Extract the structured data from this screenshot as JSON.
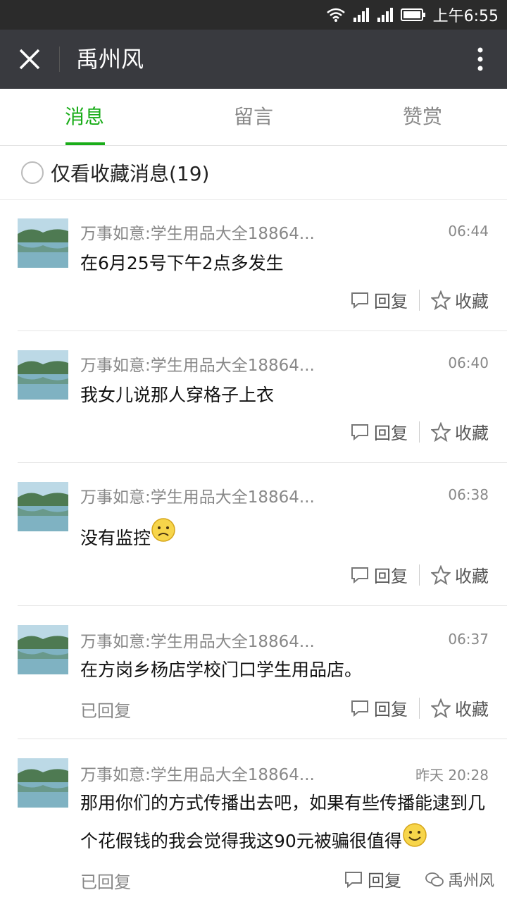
{
  "status_bar": {
    "time": "上午6:55"
  },
  "header": {
    "title": "禹州风"
  },
  "tabs": [
    {
      "label": "消息",
      "active": true
    },
    {
      "label": "留言",
      "active": false
    },
    {
      "label": "赞赏",
      "active": false
    }
  ],
  "filter": {
    "label": "仅看收藏消息(19)"
  },
  "actions": {
    "reply": "回复",
    "favorite": "收藏",
    "replied": "已回复"
  },
  "messages": [
    {
      "nickname": "万事如意:学生用品大全18864...",
      "time": "06:44",
      "content": "在6月25号下午2点多发生",
      "replied": false
    },
    {
      "nickname": "万事如意:学生用品大全18864...",
      "time": "06:40",
      "content": "我女儿说那人穿格子上衣",
      "replied": false
    },
    {
      "nickname": "万事如意:学生用品大全18864...",
      "time": "06:38",
      "content": "没有监控",
      "emoji": "sad-face-icon",
      "replied": false
    },
    {
      "nickname": "万事如意:学生用品大全18864...",
      "time": "06:37",
      "content": "在方岗乡杨店学校门口学生用品店。",
      "replied": true
    },
    {
      "nickname": "万事如意:学生用品大全18864...",
      "time": "昨天 20:28",
      "content_line1": "那用你们的方式传播出去吧，如果有些传播能逮到几",
      "content_line2": "个花假钱的我会觉得我这90元被骗很值得",
      "emoji": "smile-face-icon",
      "replied": true
    }
  ],
  "watermark": {
    "text": "禹州风"
  },
  "colors": {
    "accent": "#1aad19",
    "titlebar": "#393a3f",
    "statusbar": "#2b2b2b"
  }
}
